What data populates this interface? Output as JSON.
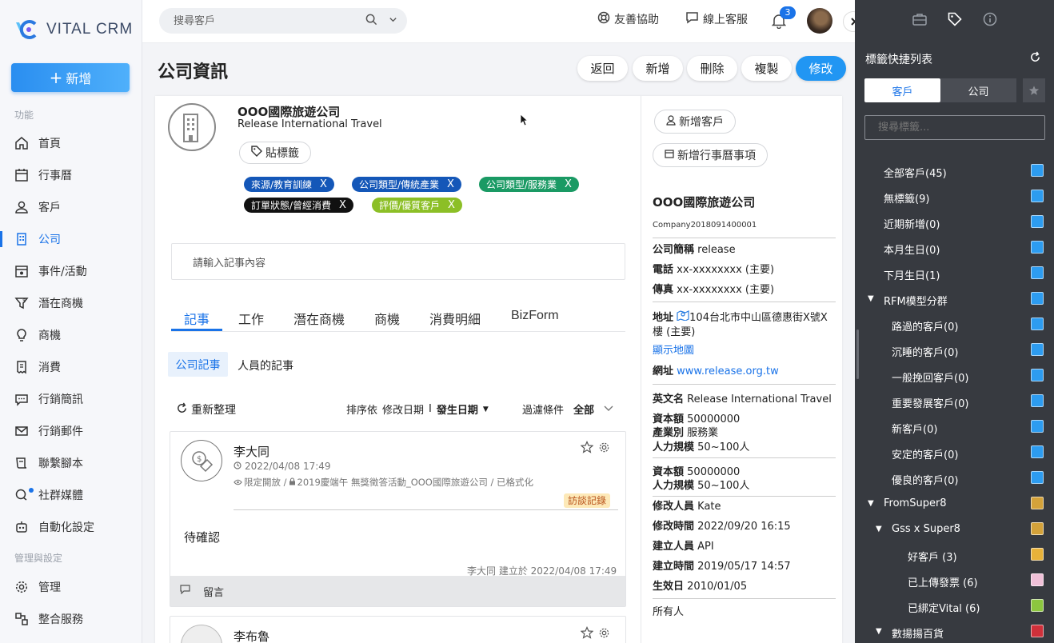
{
  "app": {
    "name": "VITAL CRM"
  },
  "sidebar": {
    "new_label": "新增",
    "section_func": "功能",
    "section_admin": "管理與設定",
    "items": [
      {
        "label": "首頁",
        "icon": "home-icon"
      },
      {
        "label": "行事曆",
        "icon": "calendar-icon"
      },
      {
        "label": "客戶",
        "icon": "person-icon"
      },
      {
        "label": "公司",
        "icon": "building-icon"
      },
      {
        "label": "事件/活動",
        "icon": "event-icon"
      },
      {
        "label": "潛在商機",
        "icon": "funnel-icon"
      },
      {
        "label": "商機",
        "icon": "lightbulb-icon"
      },
      {
        "label": "消費",
        "icon": "receipt-icon"
      },
      {
        "label": "行銷簡訊",
        "icon": "sms-icon"
      },
      {
        "label": "行銷郵件",
        "icon": "mail-icon"
      },
      {
        "label": "聯繫腳本",
        "icon": "script-icon"
      },
      {
        "label": "社群媒體",
        "icon": "chat-icon"
      },
      {
        "label": "自動化設定",
        "icon": "robot-icon"
      }
    ],
    "admin_items": [
      {
        "label": "管理",
        "icon": "gear-icon"
      },
      {
        "label": "整合服務",
        "icon": "integration-icon"
      }
    ]
  },
  "topbar": {
    "search_placeholder": "搜尋客戶",
    "help_label": "友善協助",
    "support_label": "線上客服",
    "notifications": "3"
  },
  "header": {
    "title": "公司資訊",
    "buttons": {
      "back": "返回",
      "add": "新增",
      "delete": "刪除",
      "copy": "複製",
      "edit": "修改"
    }
  },
  "company": {
    "name": "OOO國際旅遊公司",
    "en_name": "Release International Travel",
    "tag_button": "貼標籤",
    "tags": [
      {
        "label": "來源/教育訓練",
        "color": "#1457b8",
        "remove": "X"
      },
      {
        "label": "公司類型/傳統產業",
        "color": "#1457b8",
        "remove": "X"
      },
      {
        "label": "公司類型/服務業",
        "color": "#1a9a64",
        "remove": "X"
      },
      {
        "label": "訂單狀態/曾經消費",
        "color": "#111111",
        "remove": "X"
      },
      {
        "label": "評價/優質客戶",
        "color": "#8cbf26",
        "remove": "X"
      }
    ],
    "note_placeholder": "請輸入記事內容"
  },
  "tabs": [
    "記事",
    "工作",
    "潛在商機",
    "商機",
    "消費明細",
    "BizForm"
  ],
  "subtabs": [
    "公司記事",
    "人員的記事"
  ],
  "toolbar": {
    "refresh": "重新整理",
    "sort_prefix": "排序依",
    "sort_modified": "修改日期",
    "sort_sep": "I",
    "sort_created": "發生日期",
    "filter_label": "過濾條件",
    "filter_value": "全部"
  },
  "notes": [
    {
      "author": "李大同",
      "time": "2022/04/08 17:49",
      "meta": "限定開放 / ",
      "meta2": "2019慶端午 無獎徵答活動_OOO國際旅遊公司 / 已格式化",
      "badge": "訪談記錄",
      "content": "待確認",
      "footer": "李大同 建立於 2022/04/08 17:49",
      "comment_label": "留言"
    },
    {
      "author": "李布魯"
    }
  ],
  "right": {
    "add_customer": "新增客戶",
    "add_event": "新增行事曆事項",
    "company_name": "OOO國際旅遊公司",
    "company_id": "Company2018091400001",
    "short_name_label": "公司簡稱",
    "short_name": "release",
    "phone_label": "電話",
    "phone": "xx-xxxxxxxx (主要)",
    "fax_label": "傳真",
    "fax": "xx-xxxxxxxx (主要)",
    "address_label": "地址",
    "address": "104台北市中山區德惠街X號X樓 (主要)",
    "map_link": "顯示地圖",
    "website_label": "網址",
    "website": "www.release.org.tw",
    "en_name_label": "英文名",
    "en_name": "Release International Travel",
    "capital_label": "資本額",
    "capital": "50000000",
    "industry_label": "產業別",
    "industry": "服務業",
    "size_label": "人力規模",
    "size": "50~100人",
    "capital2": "50000000",
    "size2": "50~100人",
    "modifier_label": "修改人員",
    "modifier": "Kate",
    "modified_label": "修改時間",
    "modified": "2022/09/20 16:15",
    "creator_label": "建立人員",
    "creator": "API",
    "created_label": "建立時間",
    "created": "2019/05/17 14:57",
    "effective_label": "生效日",
    "effective": "2010/01/05",
    "owner_label": "所有人"
  },
  "tag_panel": {
    "title": "標籤快捷列表",
    "tab_customer": "客戶",
    "tab_company": "公司",
    "search_placeholder": "搜尋標籤...",
    "items": [
      {
        "label": "全部客戶(45)",
        "indent": 0,
        "color": "#2d9cf0"
      },
      {
        "label": "無標籤(9)",
        "indent": 0,
        "color": "#2d9cf0"
      },
      {
        "label": "近期新增(0)",
        "indent": 0,
        "color": "#2d9cf0"
      },
      {
        "label": "本月生日(0)",
        "indent": 0,
        "color": "#2d9cf0"
      },
      {
        "label": "下月生日(1)",
        "indent": 0,
        "color": "#2d9cf0"
      },
      {
        "label": "RFM模型分群",
        "indent": 0,
        "color": "#2d9cf0",
        "group": true
      },
      {
        "label": "路過的客戶(0)",
        "indent": 1,
        "color": "#2d9cf0"
      },
      {
        "label": "沉睡的客戶(0)",
        "indent": 1,
        "color": "#2d9cf0"
      },
      {
        "label": "一般挽回客戶(0)",
        "indent": 1,
        "color": "#2d9cf0"
      },
      {
        "label": "重要發展客戶(0)",
        "indent": 1,
        "color": "#2d9cf0"
      },
      {
        "label": "新客戶(0)",
        "indent": 1,
        "color": "#2d9cf0"
      },
      {
        "label": "安定的客戶(0)",
        "indent": 1,
        "color": "#2d9cf0"
      },
      {
        "label": "優良的客戶(0)",
        "indent": 1,
        "color": "#2d9cf0"
      },
      {
        "label": "FromSuper8",
        "indent": 0,
        "color": "#d4a23a",
        "group": true
      },
      {
        "label": "Gss x Super8",
        "indent": 1,
        "color": "#d4a23a",
        "group": true
      },
      {
        "label": "好客戶 (3)",
        "indent": 2,
        "color": "#e8b23a"
      },
      {
        "label": "已上傳發票 (6)",
        "indent": 2,
        "color": "#f0c0d8"
      },
      {
        "label": "已綁定Vital (6)",
        "indent": 2,
        "color": "#8cc63f"
      },
      {
        "label": "數揚揚百貨",
        "indent": 1,
        "color": "#d0303a",
        "group": true
      }
    ]
  }
}
